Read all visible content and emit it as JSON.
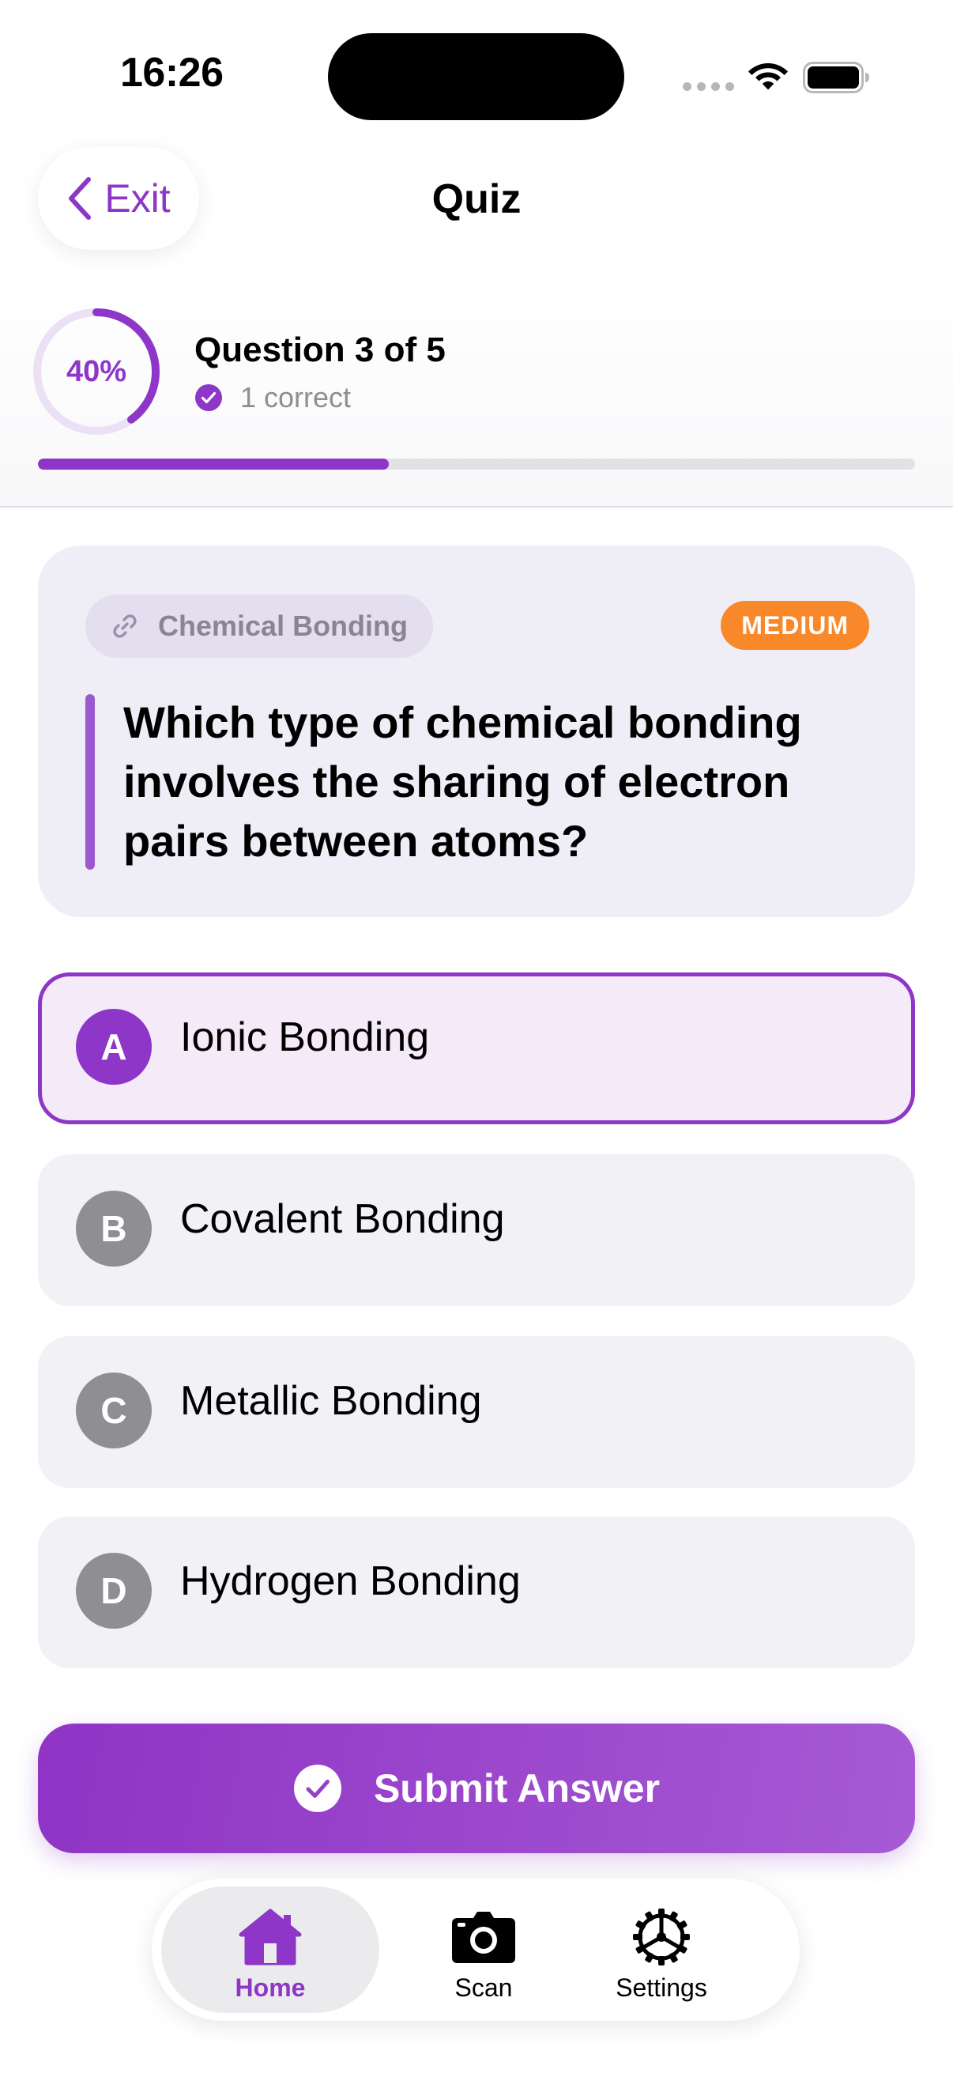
{
  "status_bar": {
    "time": "16:26"
  },
  "header": {
    "exit_label": "Exit",
    "title": "Quiz"
  },
  "progress": {
    "percent_label": "40%",
    "percent_value": 0.4,
    "question_counter": "Question 3 of 5",
    "correct_label": "1 correct"
  },
  "question": {
    "topic": "Chemical Bonding",
    "difficulty": "MEDIUM",
    "text": "Which type of chemical bonding involves the sharing of electron pairs between atoms?"
  },
  "options": [
    {
      "letter": "A",
      "text": "Ionic Bonding",
      "selected": true
    },
    {
      "letter": "B",
      "text": "Covalent Bonding",
      "selected": false
    },
    {
      "letter": "C",
      "text": "Metallic Bonding",
      "selected": false
    },
    {
      "letter": "D",
      "text": "Hydrogen Bonding",
      "selected": false
    }
  ],
  "submit": {
    "label": "Submit Answer"
  },
  "tabs": [
    {
      "label": "Home",
      "icon": "house-icon",
      "active": true
    },
    {
      "label": "Scan",
      "icon": "camera-icon",
      "active": false
    },
    {
      "label": "Settings",
      "icon": "gear-icon",
      "active": false
    }
  ],
  "colors": {
    "accent": "#8d36c8",
    "difficulty_medium": "#f8882a",
    "option_unselected_badge": "#8e8e93",
    "card_background": "#efedf5"
  }
}
